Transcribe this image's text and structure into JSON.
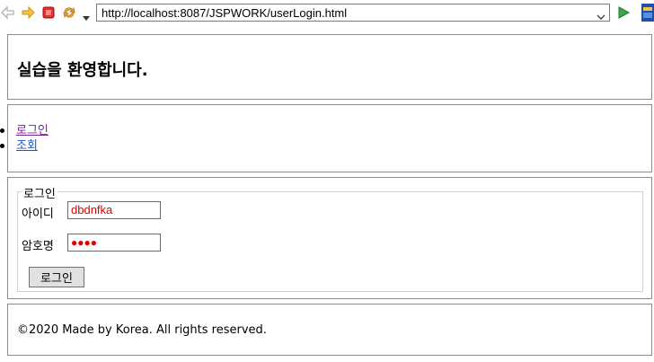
{
  "browser": {
    "url": "http://localhost:8087/JSPWORK/userLogin.html",
    "icons": [
      "back-arrow-icon",
      "forward-arrow-icon",
      "stop-icon",
      "refresh-icon",
      "dropdown-arrow-icon",
      "go-icon",
      "app-icon"
    ]
  },
  "header": {
    "title": "실습을 환영합니다."
  },
  "nav": {
    "items": [
      {
        "label": "로그인"
      },
      {
        "label": "조회"
      }
    ]
  },
  "login_form": {
    "legend": "로그인",
    "id_label": "아이디",
    "id_value": "dbdnfka",
    "password_label": "암호명",
    "password_value": "●●●●",
    "submit_label": "로그인"
  },
  "footer": {
    "text": "©2020 Made by Korea. All rights reserved."
  },
  "colors": {
    "input_text": "#e00000",
    "visited_link": "#7b1fa2",
    "link": "#1a56c8",
    "border": "#8c8c8c"
  }
}
